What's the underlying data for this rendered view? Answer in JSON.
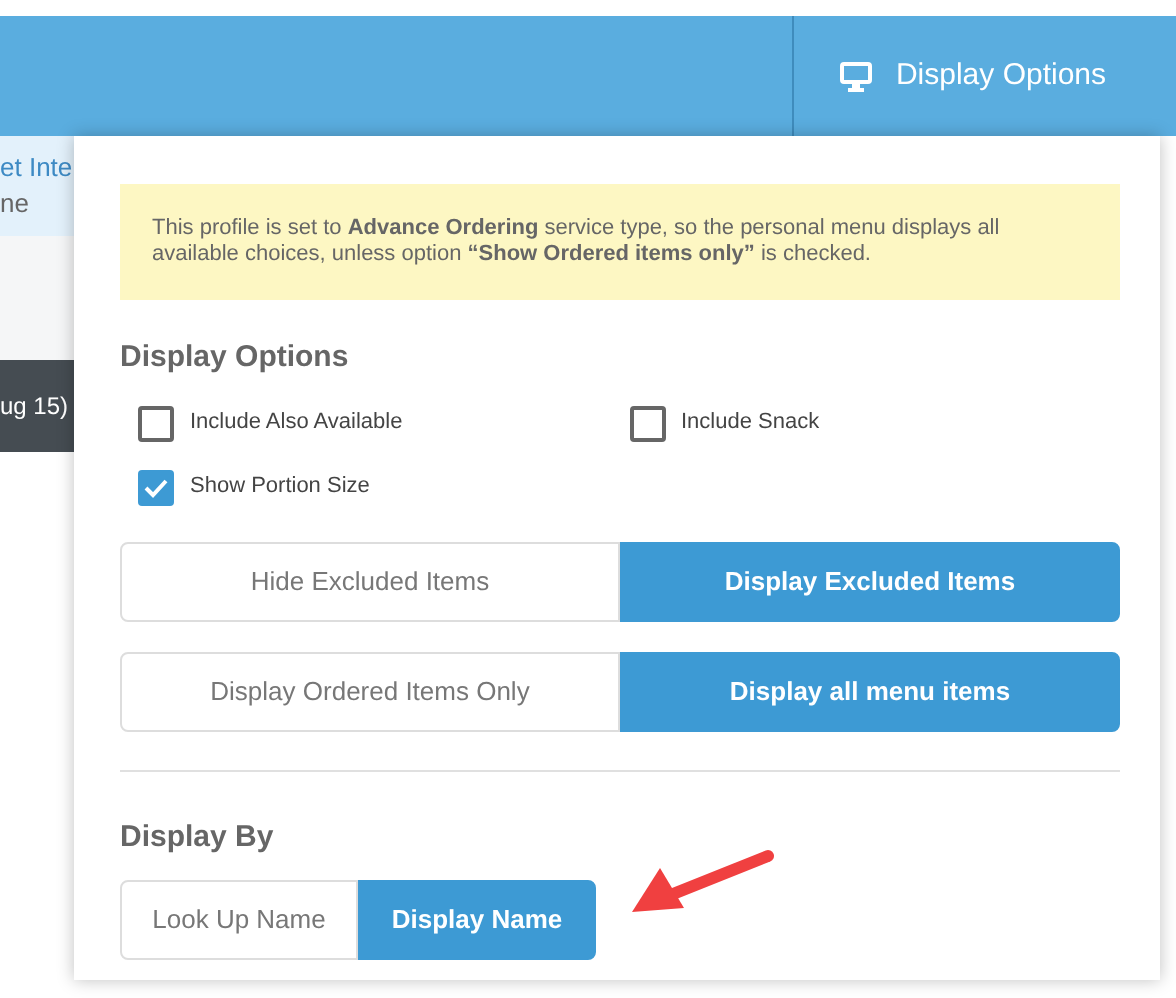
{
  "header": {
    "button": "Display Options"
  },
  "background": {
    "link": "et Inte",
    "caption": "ne",
    "bar_text": "ug 15)"
  },
  "notice": "This profile is set to **Advance Ordering** service type, so the personal menu displays all available choices, unless option **“Show Ordered items only”** is checked.",
  "display_options": {
    "title": "Display Options",
    "checkboxes": [
      {
        "label": "Include Also Available",
        "checked": false
      },
      {
        "label": "Include Snack",
        "checked": false
      },
      {
        "label": "Show Portion Size",
        "checked": true
      }
    ],
    "toggle_groups": [
      {
        "options": [
          {
            "label": "Hide Excluded Items",
            "selected": false
          },
          {
            "label": "Display Excluded Items",
            "selected": true
          }
        ]
      },
      {
        "options": [
          {
            "label": "Display Ordered Items Only",
            "selected": false
          },
          {
            "label": "Display all menu items",
            "selected": true
          }
        ]
      }
    ]
  },
  "display_by": {
    "title": "Display By",
    "options": [
      {
        "label": "Look Up Name",
        "selected": false
      },
      {
        "label": "Display Name",
        "selected": true
      }
    ]
  }
}
